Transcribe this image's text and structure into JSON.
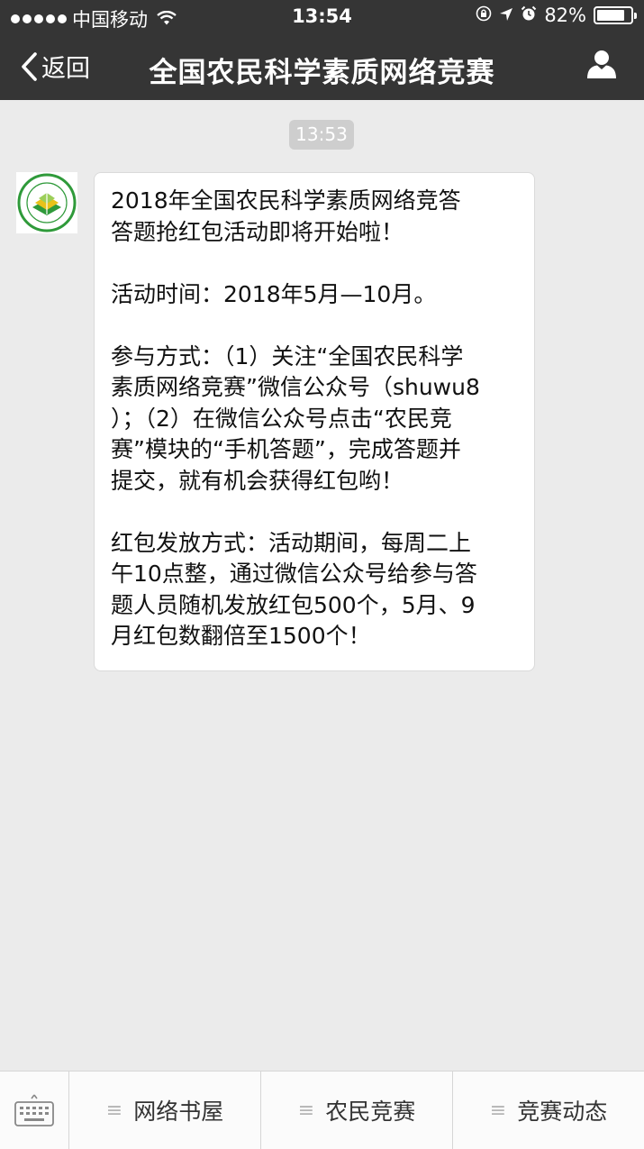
{
  "status_bar": {
    "carrier": "中国移动",
    "time": "13:54",
    "battery": "82%",
    "battery_level": 0.82,
    "icons": [
      "signal-dots-icon",
      "wifi-icon",
      "rotation-lock-icon",
      "location-arrow-icon",
      "alarm-icon",
      "battery-icon"
    ]
  },
  "nav": {
    "back_label": "返回",
    "title": "全国农民科学素质网络竞赛",
    "profile_icon": "person-icon"
  },
  "chat": {
    "timestamp": "13:53",
    "avatar_icon": "competition-logo-icon",
    "message": {
      "paragraphs": [
        "2018年全国农民科学素质网络竞答\n答题抢红包活动即将开始啦！",
        "活动时间：2018年5月—10月。",
        "参与方式：（1）关注“全国农民科学\n素质网络竞赛”微信公众号（shuwu8\n）；（2）在微信公众号点击“农民竞\n赛”模块的“手机答题”，完成答题并\n提交，就有机会获得红包哟！",
        "红包发放方式：活动期间，每周二上\n午10点整，通过微信公众号给参与答\n题人员随机发放红包500个，5月、9\n月红包数翻倍至1500个！"
      ]
    }
  },
  "bottom_menu": {
    "keyboard_icon": "keyboard-icon",
    "items": [
      {
        "label": "网络书屋",
        "icon": "menu-lines-icon"
      },
      {
        "label": "农民竞赛",
        "icon": "menu-lines-icon"
      },
      {
        "label": "竞赛动态",
        "icon": "menu-lines-icon"
      }
    ]
  },
  "colors": {
    "top_bar": "#353535",
    "chat_background": "#ebebeb",
    "bubble": "#ffffff",
    "timestamp_bg": "#cecece",
    "logo_green": "#2f9a3a",
    "logo_yellow": "#e8c21a"
  }
}
